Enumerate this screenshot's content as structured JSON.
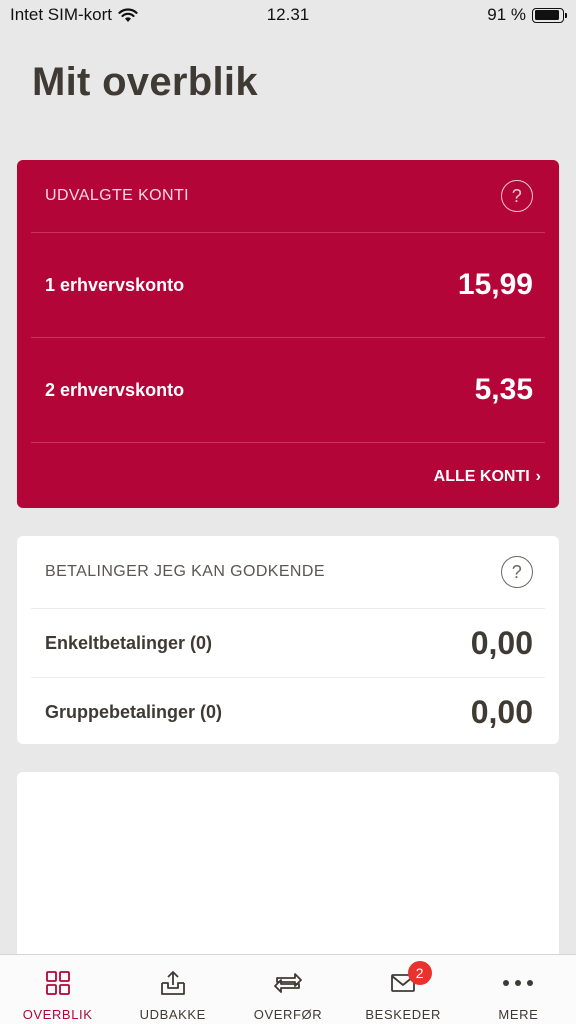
{
  "status_bar": {
    "carrier": "Intet SIM-kort",
    "time": "12.31",
    "battery": "91 %",
    "battery_level": 0.91
  },
  "page": {
    "title": "Mit overblik"
  },
  "selected_accounts": {
    "header": "UDVALGTE KONTI",
    "help_icon": "?",
    "accounts": [
      {
        "name": "1 erhvervskonto",
        "amount": "15,99"
      },
      {
        "name": "2 erhvervskonto",
        "amount": "5,35"
      }
    ],
    "all_accounts_label": "ALLE KONTI",
    "chevron": "›"
  },
  "payments": {
    "header": "BETALINGER JEG KAN GODKENDE",
    "help_icon": "?",
    "rows": [
      {
        "name": "Enkeltbetalinger (0)",
        "amount": "0,00"
      },
      {
        "name": "Gruppebetalinger (0)",
        "amount": "0,00"
      }
    ]
  },
  "tabbar": {
    "tabs": [
      {
        "label": "OVERBLIK",
        "icon": "grid-icon",
        "active": true
      },
      {
        "label": "UDBAKKE",
        "icon": "outbox-icon"
      },
      {
        "label": "OVERFØR",
        "icon": "transfer-icon"
      },
      {
        "label": "BESKEDER",
        "icon": "envelope-icon",
        "badge": "2"
      },
      {
        "label": "MERE",
        "icon": "more-icon"
      }
    ]
  },
  "colors": {
    "accent": "#b40538",
    "background": "#e9e8e9",
    "badge": "#e8322d"
  }
}
